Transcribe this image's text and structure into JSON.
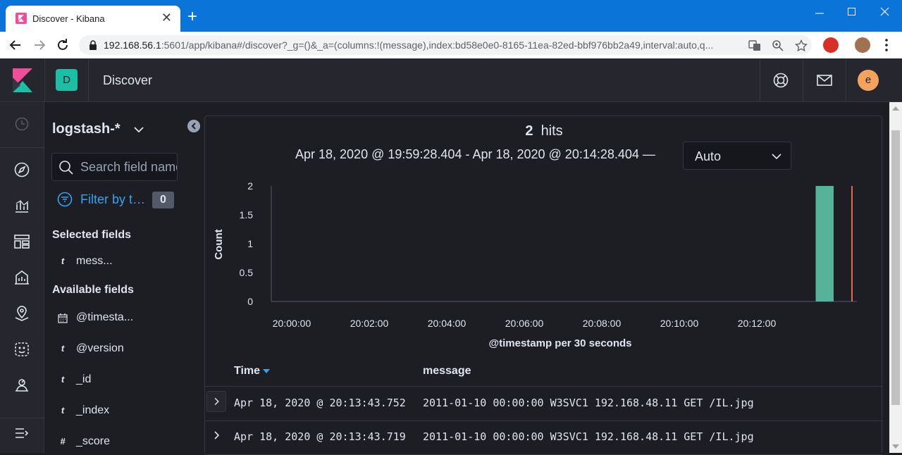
{
  "browser": {
    "tab_title": "Discover - Kibana",
    "tab_close": "✕",
    "new_tab": "+",
    "url_host": "192.168.56.1",
    "url_rest": ":5601/app/kibana#/discover?_g=()&_a=(columns:!(message),index:bd58e0e0-8165-11ea-82ed-bbf976bb2a49,interval:auto,q..."
  },
  "header": {
    "space_initial": "D",
    "page_title": "Discover",
    "user_initial": "e"
  },
  "sidebar": {
    "index_pattern": "logstash-*",
    "search_placeholder": "Search field names",
    "filter_label": "Filter by type",
    "filter_count": "0",
    "selected_title": "Selected fields",
    "selected_fields": [
      {
        "type": "t",
        "name": "mess..."
      }
    ],
    "available_title": "Available fields",
    "available_fields": [
      {
        "type": "cal",
        "name": "@timesta..."
      },
      {
        "type": "t",
        "name": "@version"
      },
      {
        "type": "t",
        "name": "_id"
      },
      {
        "type": "t",
        "name": "_index"
      },
      {
        "type": "#",
        "name": "_score"
      }
    ]
  },
  "main": {
    "hits_count": "2",
    "hits_label": "hits",
    "time_range": "Apr 18, 2020 @ 19:59:28.404 - Apr 18, 2020 @ 20:14:28.404 —",
    "interval_value": "Auto"
  },
  "chart_data": {
    "type": "bar",
    "ylabel": "Count",
    "xlabel": "@timestamp per 30 seconds",
    "x_ticks": [
      "20:00:00",
      "20:02:00",
      "20:04:00",
      "20:06:00",
      "20:08:00",
      "20:10:00",
      "20:12:00"
    ],
    "y_ticks": [
      "2",
      "1.5",
      "1",
      "0.5",
      "0"
    ],
    "ylim": [
      0,
      2
    ],
    "series": [
      {
        "values": [
          {
            "x": "20:13:30",
            "y": 2
          }
        ],
        "color": "#54b399"
      }
    ],
    "now_marker_color": "#e7664c"
  },
  "table": {
    "columns": [
      "Time",
      "message"
    ],
    "rows": [
      {
        "time": "Apr 18, 2020 @ 20:13:43.752",
        "message": "2011-01-10 00:00:00 W3SVC1 192.168.48.11 GET /IL.jpg"
      },
      {
        "time": "Apr 18, 2020 @ 20:13:43.719",
        "message": "2011-01-10 00:00:00 W3SVC1 192.168.48.11 GET /IL.jpg"
      }
    ]
  },
  "colors": {
    "accent": "#36a2ef",
    "bar": "#54b399",
    "space_badge": "#1bbfa5",
    "avatar": "#f5a35c"
  }
}
